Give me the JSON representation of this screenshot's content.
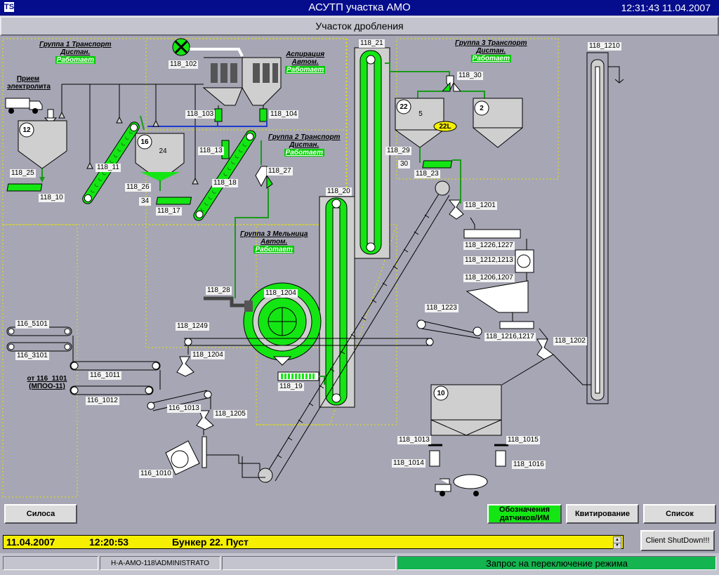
{
  "window": {
    "app_icon": "TS",
    "title": "АСУТП участка АМО",
    "clock": "12:31:43 11.04.2007"
  },
  "page": {
    "subtitle": "Участок дробления"
  },
  "groups": {
    "g1": {
      "line1": "Группа 1 Транспорт",
      "line2": "Дистан.",
      "state": "Работает"
    },
    "asp": {
      "line1": "Аспирация",
      "line2": "Автом.",
      "state": "Работает"
    },
    "g2": {
      "line1": "Группа 2 Транспорт",
      "line2": "Дистан.",
      "state": "Работает"
    },
    "g3t": {
      "line1": "Группа 3 Транспорт",
      "line2": "Дистан.",
      "state": "Работает"
    },
    "g3m": {
      "line1": "Группа 3 Мельница",
      "line2": "Автом.",
      "state": "Работает"
    }
  },
  "labels": {
    "receive": "Прием электролита",
    "from": "от 116_1101 (МПОО-11)"
  },
  "bunkers": {
    "b12": "12",
    "b16": "16",
    "b16_val": "24",
    "b22": "22",
    "b22_val": "5",
    "b22_level": "22L",
    "b2": "2",
    "b10": "10"
  },
  "values": {
    "v34": "34",
    "v30": "30"
  },
  "tags": {
    "t118_102": "118_102",
    "t118_103": "118_103",
    "t118_104": "118_104",
    "t118_11": "118_11",
    "t118_25": "118_25",
    "t118_10": "118_10",
    "t118_26": "118_26",
    "t118_17": "118_17",
    "t118_13": "118_13",
    "t118_18": "118_18",
    "t118_27": "118_27",
    "t118_21": "118_21",
    "t118_30": "118_30",
    "t118_29": "118_29",
    "t118_23": "118_23",
    "t118_20": "118_20",
    "t118_1201": "118_1201",
    "t118_1210": "118_1210",
    "t118_1226": "118_1226,1227",
    "t118_1212": "118_1212,1213",
    "t118_1206": "118_1206,1207",
    "t118_1223": "118_1223",
    "t118_1216": "118_1216,1217",
    "t118_1202": "118_1202",
    "t118_28": "118_28",
    "t118_1204a": "118_1204",
    "t118_1249": "118_1249",
    "t118_1204b": "118_1204",
    "t118_19": "118_19",
    "t116_5101": "116_5101",
    "t116_3101": "116_3101",
    "t116_1011": "116_1011",
    "t116_1012": "116_1012",
    "t116_1013": "116_1013",
    "t118_1205": "118_1205",
    "t116_1010": "116_1010",
    "t118_1013": "118_1013",
    "t118_1014": "118_1014",
    "t118_1015": "118_1015",
    "t118_1016": "118_1016"
  },
  "buttons": {
    "silosa": "Силоса",
    "sensors": "Обозначения датчиков/ИМ",
    "ack": "Квитирование",
    "list": "Список",
    "shutdown": "Client ShutDown!!!"
  },
  "status": {
    "date": "11.04.2007",
    "time": "12:20:53",
    "message": "Бункер 22. Пуст"
  },
  "footer": {
    "user": "H-A-AMO-118\\ADMINISTRATO",
    "mode_msg": "Запрос на переключение режима"
  },
  "colors": {
    "titlebar": "#050d8c",
    "background": "#a6a6b5",
    "running": "#14e614",
    "alarm": "#f6f000"
  }
}
